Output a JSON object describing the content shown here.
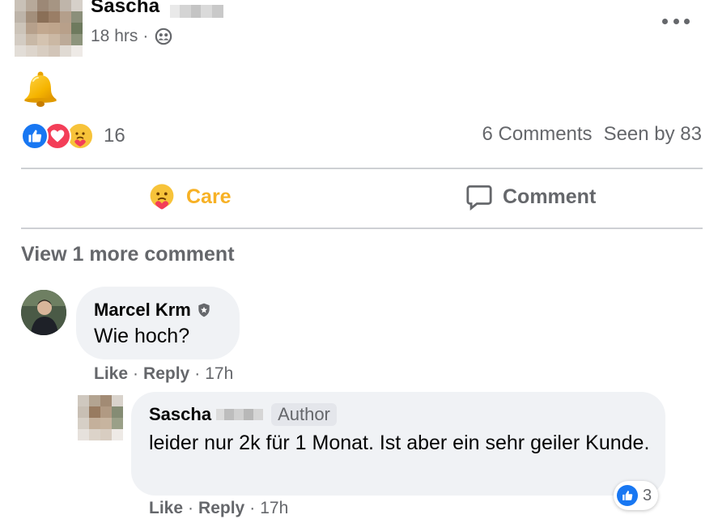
{
  "post": {
    "author": "Sascha",
    "time": "18 hrs",
    "separator": "·",
    "audience_icon": "friends-icon",
    "content_emoji": "bell-emoji"
  },
  "reactions": {
    "types": [
      "like",
      "love",
      "care"
    ],
    "count": "16",
    "comments_label": "6 Comments",
    "seen_label": "Seen by 83"
  },
  "actions": {
    "care_label": "Care",
    "comment_label": "Comment"
  },
  "comments": {
    "view_more": "View 1 more comment",
    "items": [
      {
        "author": "Marcel Krm",
        "text": "Wie hoch?",
        "like": "Like",
        "reply": "Reply",
        "time": "17h"
      },
      {
        "author": "Sascha",
        "badge": "Author",
        "text": "leider nur 2k für 1 Monat. Ist aber ein sehr geiler Kunde.",
        "like": "Like",
        "reply": "Reply",
        "time": "17h",
        "reaction_count": "3"
      }
    ],
    "dot": "·"
  },
  "colors": {
    "care": "#f7b125",
    "secondary_text": "#65676b",
    "bubble": "#f0f2f5",
    "like_blue": "#1877f2",
    "love_red": "#f33e58"
  }
}
